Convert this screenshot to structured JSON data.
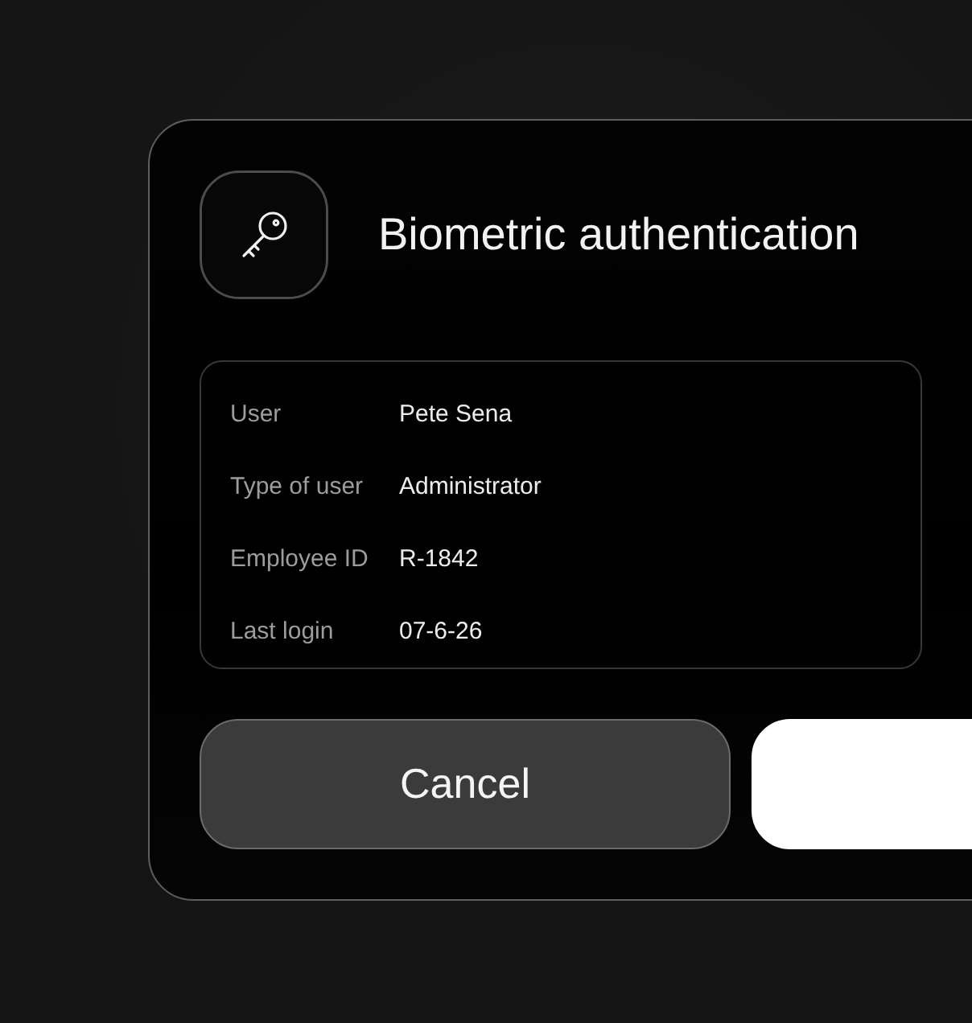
{
  "dialog": {
    "title": "Biometric authentication",
    "details": [
      {
        "label": "User",
        "value": "Pete Sena"
      },
      {
        "label": "Type of user",
        "value": "Administrator"
      },
      {
        "label": "Employee ID",
        "value": "R-1842"
      },
      {
        "label": "Last login",
        "value": "07-6-26"
      }
    ],
    "buttons": [
      {
        "kind": "secondary",
        "label": "Cancel"
      },
      {
        "kind": "primary"
      }
    ]
  }
}
